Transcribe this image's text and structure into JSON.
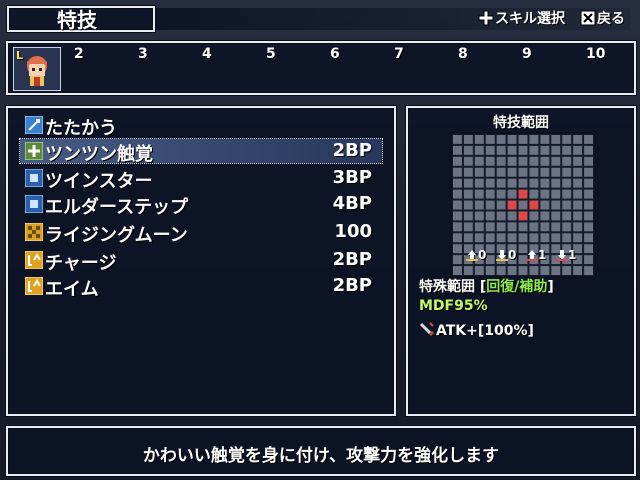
{
  "header": {
    "title": "特技",
    "hint_select": "スキル選択",
    "hint_back": "戻る"
  },
  "party": {
    "leader_badge": "L",
    "slots": [
      "2",
      "3",
      "4",
      "5",
      "6",
      "7",
      "8",
      "9",
      "10"
    ]
  },
  "skills": [
    {
      "name": "たたかう",
      "cost": "",
      "icon": "sword-icon",
      "selected": false
    },
    {
      "name": "ツンツン触覚",
      "cost": "2BP",
      "icon": "plus-icon",
      "selected": true
    },
    {
      "name": "ツインスター",
      "cost": "3BP",
      "icon": "square-icon",
      "selected": false
    },
    {
      "name": "エルダーステップ",
      "cost": "4BP",
      "icon": "square-icon",
      "selected": false
    },
    {
      "name": "ライジングムーン",
      "cost": "100",
      "icon": "star-pattern-icon",
      "selected": false
    },
    {
      "name": "チャージ",
      "cost": "2BP",
      "icon": "buff-icon",
      "selected": false
    },
    {
      "name": "エイム",
      "cost": "2BP",
      "icon": "buff-icon",
      "selected": false
    }
  ],
  "range": {
    "title": "特技範囲",
    "counts": [
      "0",
      "0",
      "1",
      "1"
    ],
    "special_label": "特殊範囲 [",
    "special_value": "回復/補助",
    "special_close": "]",
    "mdf": "MDF95%",
    "effect": "ATK+[100%]",
    "effect_icon": "sword-up-icon"
  },
  "help": {
    "text": "かわいい触覚を身に付け、攻撃力を強化します"
  },
  "colors": {
    "accent_green": "#8fea4c",
    "selection": "#6f8fd0",
    "range_cell": "#e04848"
  }
}
